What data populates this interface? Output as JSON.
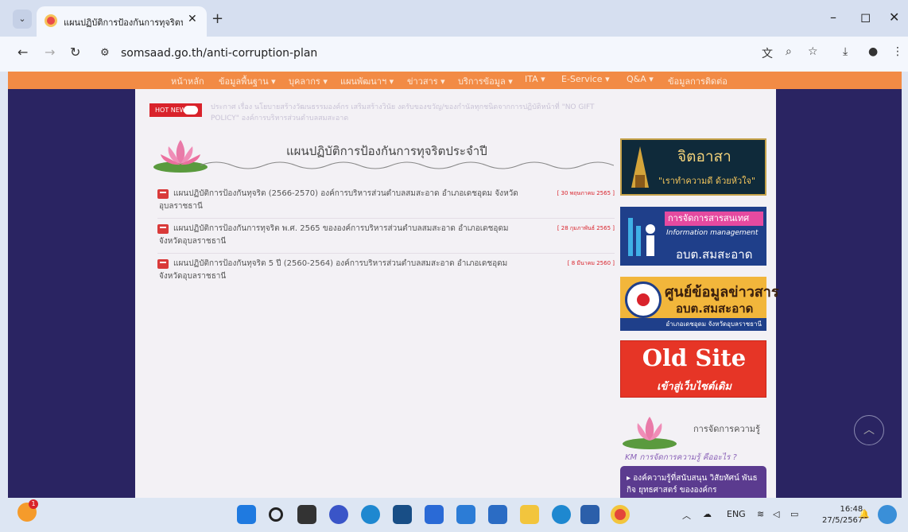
{
  "browser": {
    "tab_title": "แผนปฏิบัติการป้องกันการทุจริตประ",
    "tab_close": "✕",
    "new_tab": "+",
    "url": "somsaad.go.th/anti-corruption-plan",
    "window_controls": {
      "minimize": "–",
      "restore": "◻",
      "close": "✕"
    }
  },
  "nav": {
    "items": [
      "หน้าหลัก",
      "ข้อมูลพื้นฐาน ▾",
      "บุคลากร ▾",
      "แผนพัฒนาฯ ▾",
      "ข่าวสาร ▾",
      "บริการข้อมูล ▾",
      "ITA ▾",
      "E-Service ▾",
      "Q&A ▾",
      "ข้อมูลการติดต่อ"
    ]
  },
  "hot_news": {
    "label": "HOT NEWS",
    "text": "ประกาศ เรื่อง นโยบายสร้างวัฒนธรรมองค์กร เสริมสร้างวินัย งดรับของขวัญ/ของกำนัลทุกชนิดจากการปฏิบัติหน้าที่ \"NO GIFT POLICY\" องค์การบริหารส่วนตำบลสมสะอาด"
  },
  "page": {
    "heading": "แผนปฏิบัติการป้องกันการทุจริตประจำปี",
    "documents": [
      {
        "title": "แผนปฏิบัติการป้องกันทุจริต (2566-2570) องค์การบริหารส่วนตำบลสมสะอาด อำเภอเดชอุดม จังหวัดอุบลราชธานี",
        "date": "[ 30 พฤษภาคม 2565 ]"
      },
      {
        "title": "แผนปฏิบัติการป้องกันการทุจริต พ.ศ. 2565 ขององค์การบริหารส่วนตำบลสมสะอาด อำเภอเดชอุดม จังหวัดอุบลราชธานี",
        "date": "[ 28 กุมภาพันธ์ 2565 ]"
      },
      {
        "title": "แผนปฏิบัติการป้องกันทุจริต 5 ปี (2560-2564) องค์การบริหารส่วนตำบลสมสะอาด อำเภอเดชอุดม จังหวัดอุบลราชธานี",
        "date": "[ 8 มีนาคม 2560 ]"
      }
    ]
  },
  "sidebar": {
    "banner1": {
      "title": "จิตอาสา",
      "subtitle": "\"เราทำความดี ด้วยหัวใจ\""
    },
    "banner2": {
      "title": "การจัดการสารสนเทศ",
      "subtitle": "Information management",
      "org": "อบต.สมสะอาด"
    },
    "banner3": {
      "title": "ศูนย์ข้อมูลข่าวสาร",
      "org": "อบต.สมสะอาด",
      "location": "อำเภอเดชอุดม จังหวัดอุบลราชธานี"
    },
    "banner4": {
      "title": "Old Site",
      "subtitle": "เข้าสู่เว็บไซต์เดิม"
    },
    "km": {
      "heading": "การจัดการความรู้",
      "subheading": "KM การจัดการความรู้ คืออะไร ?",
      "item": "▸ องค์ความรู้ที่สนับสนุน วิสัยทัศน์ พันธกิจ ยุทธศาสตร์ ขององค์กร"
    }
  },
  "taskbar": {
    "tray_lang": "ENG",
    "time": "16:48",
    "date": "27/5/2567"
  },
  "colors": {
    "navbar": "#f28b45",
    "hotnews": "#d9232b",
    "background_band": "#2a2462",
    "oldsite": "#e63526"
  }
}
